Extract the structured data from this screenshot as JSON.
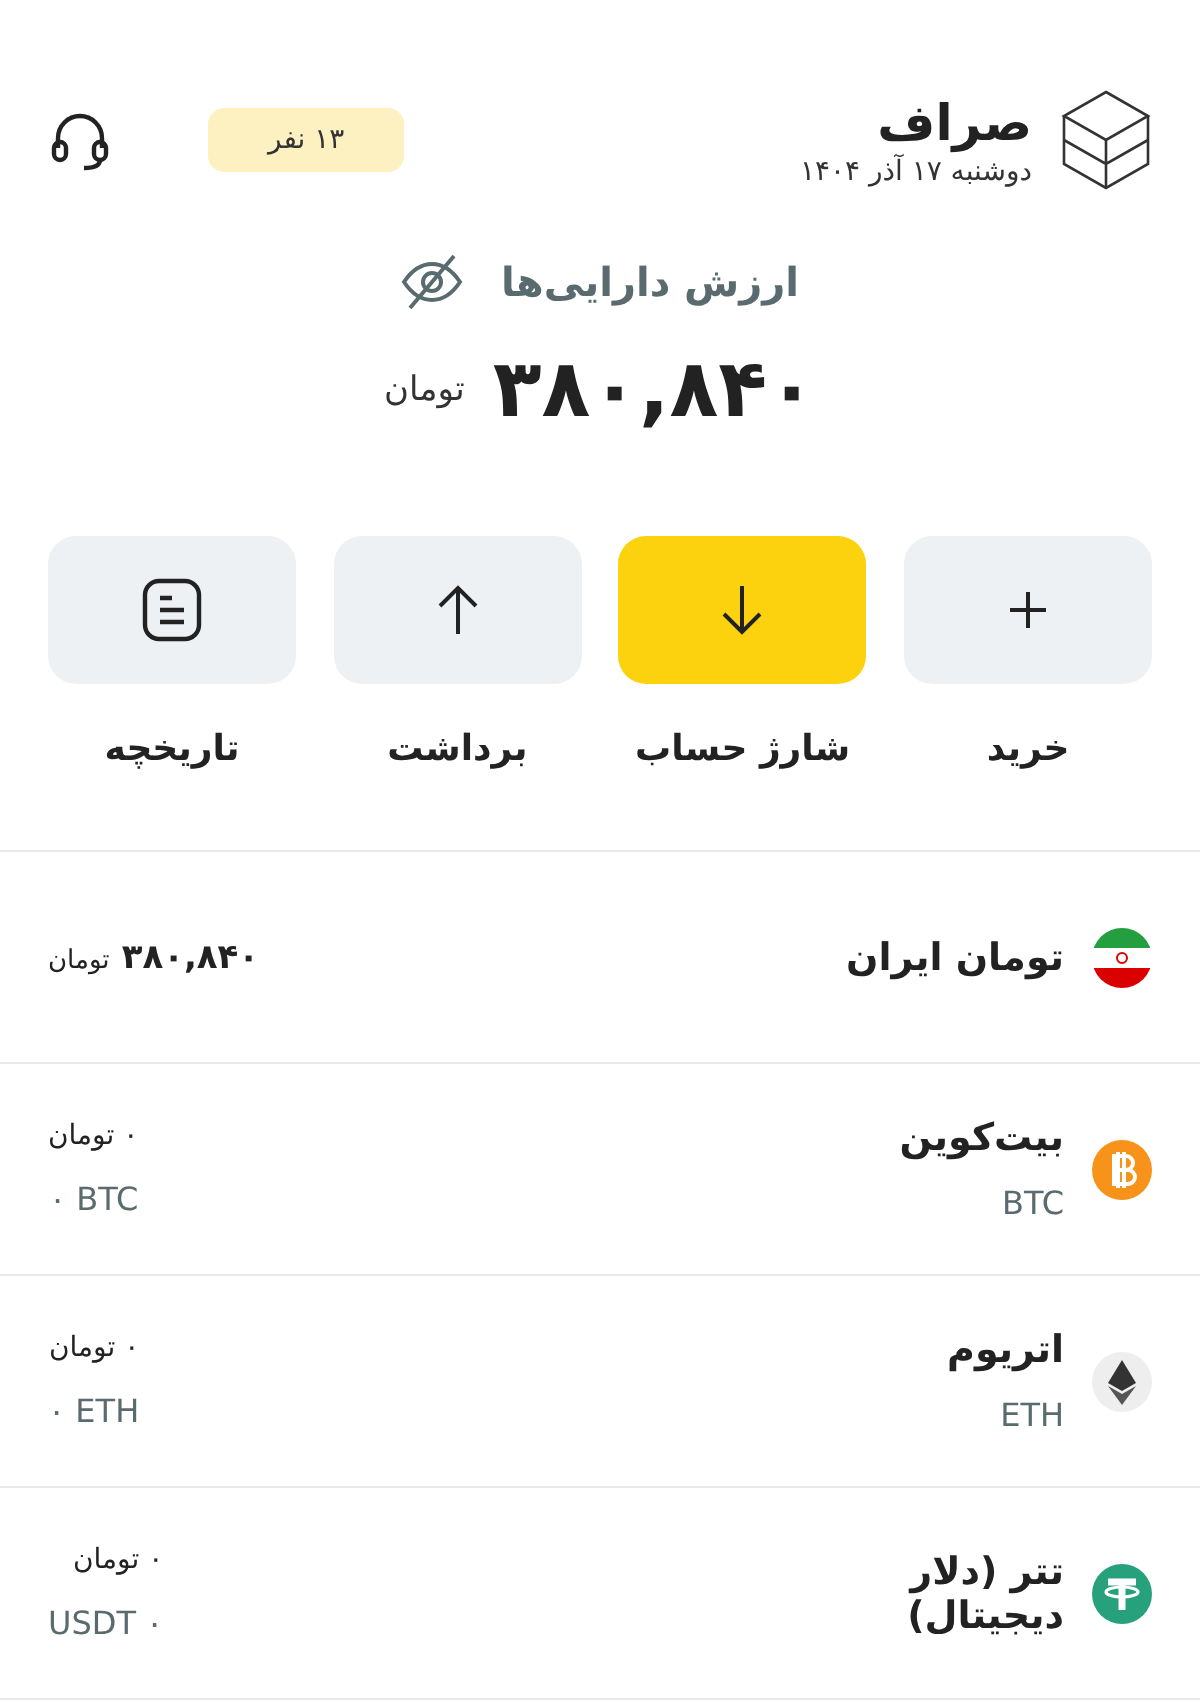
{
  "header": {
    "title": "صراف",
    "date": "دوشنبه ۱۷ آذر ۱۴۰۴",
    "badge": "۱۳ نفر"
  },
  "balance": {
    "label": "ارزش دارایی‌ها",
    "amount": "۳۸۰,۸۴۰",
    "unit": "تومان"
  },
  "actions": [
    {
      "kind": "plus",
      "label": "خرید",
      "primary": false
    },
    {
      "kind": "down",
      "label": "شارژ حساب",
      "primary": true
    },
    {
      "kind": "up",
      "label": "برداشت",
      "primary": false
    },
    {
      "kind": "history",
      "label": "تاریخچه",
      "primary": false
    }
  ],
  "assets": [
    {
      "kind": "flag",
      "name": "تومان ایران",
      "value": "۳۸۰,۸۴۰",
      "unit": "تومان"
    },
    {
      "kind": "bitcoin",
      "name": "بیت‌کوین",
      "symbol": "BTC",
      "value": "۰ تومان",
      "balance": "۰ BTC"
    },
    {
      "kind": "ethereum",
      "name": "اتریوم",
      "symbol": "ETH",
      "value": "۰ تومان",
      "balance": "۰ ETH"
    },
    {
      "kind": "tether",
      "name": "تتر (دلار دیجیتال)",
      "value": "۰ تومان",
      "balance": "USDT ۰"
    }
  ]
}
